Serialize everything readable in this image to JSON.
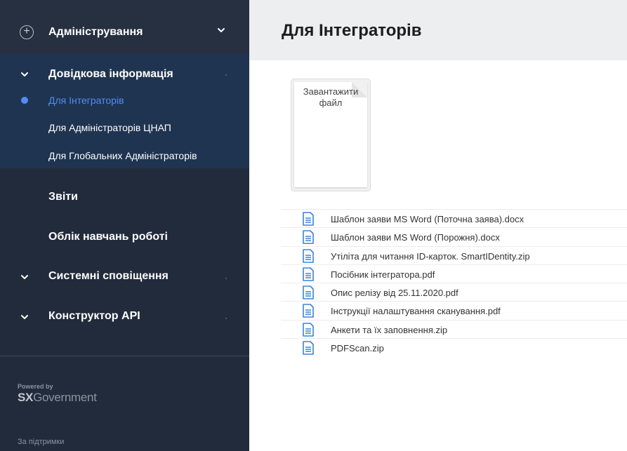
{
  "sidebar": {
    "admin_label": "Адміністрування",
    "reference_group": {
      "title": "Довідкова інформація",
      "items": [
        {
          "label": "Для Інтеграторів",
          "active": true
        },
        {
          "label": "Для Адміністраторів ЦНАП",
          "active": false
        },
        {
          "label": "Для Глобальних Адміністраторів",
          "active": false
        }
      ]
    },
    "menu": {
      "reports": "Звіти",
      "training": "Облік навчань роботі",
      "notifications": "Системні сповіщення",
      "api": "Конструктор API"
    },
    "footer": {
      "powered_by": "Powered by",
      "brand_bold": "SX",
      "brand_rest": "Government",
      "support": "За підтримки"
    }
  },
  "main": {
    "title": "Для Інтеграторів",
    "upload_label": "Завантажити файл",
    "files": [
      "Шаблон заяви MS Word (Поточна заява).docx",
      "Шаблон заяви MS Word (Порожня).docx",
      "Утіліта для читання ID-карток. SmartIDentity.zip",
      "Посібник інтегратора.pdf",
      "Опис релізу від 25.11.2020.pdf",
      "Інструкції налаштування сканування.pdf",
      "Анкети та їх заповнення.zip",
      "PDFScan.zip"
    ]
  },
  "colors": {
    "sidebar_bg": "#222b3b",
    "active_block_bg": "#1f3450",
    "accent": "#4f8ef7",
    "header_bg": "#edeef0",
    "file_icon": "#3b82d8"
  },
  "icons": {
    "admin": "plus-circle-icon",
    "collapse": "chevron-down-icon",
    "file": "document-icon"
  }
}
